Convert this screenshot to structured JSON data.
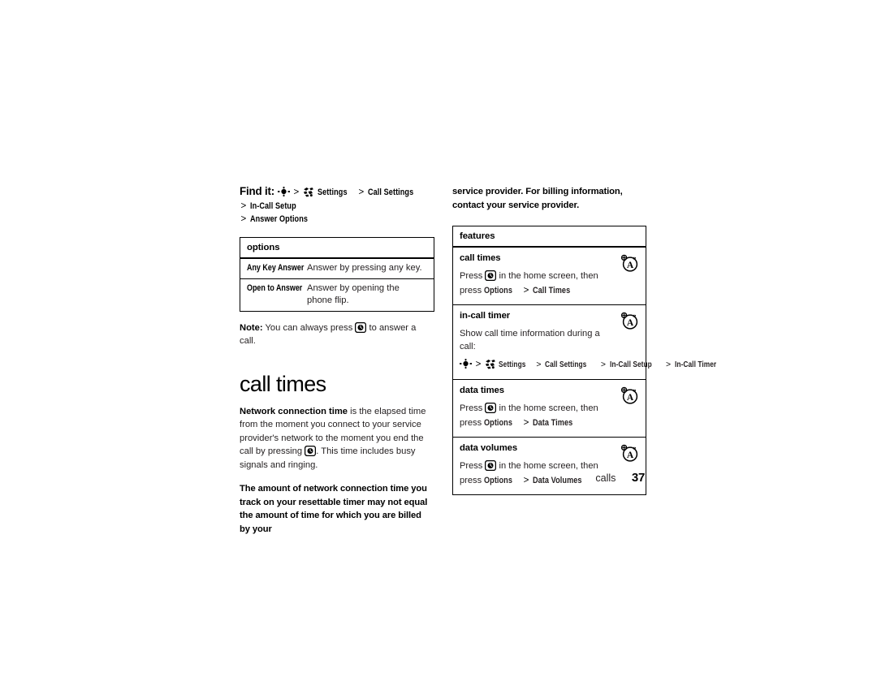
{
  "page": {
    "footer_section": "calls",
    "footer_page_number": "37"
  },
  "left_column": {
    "find_it": {
      "lead_label": "Find it:",
      "nav_icon": "navigation-key-icon",
      "menu_icon": "main-menu-icon",
      "separator": ">",
      "path": [
        "Settings",
        "Call Settings",
        "In-Call Setup",
        "Answer Options"
      ]
    },
    "options_table": {
      "header": "options",
      "rows": [
        {
          "key": "Any Key Answer",
          "value": "Answer by pressing any key."
        },
        {
          "key": "Open to Answer",
          "value": "Answer by opening the phone flip."
        }
      ]
    },
    "note": {
      "label": "Note:",
      "text_before_icon": "You can always press",
      "key_icon": "send-key-icon",
      "text_after_icon": "to answer a call."
    },
    "heading": "call times",
    "paragraph_1": {
      "bold_lead": "Network connection time",
      "text_before_icon": "is the elapsed time from the moment you connect to your service provider's network to the moment you end the call by pressing",
      "key_icon": "end-key-icon",
      "text_after_icon": ". This time includes busy signals and ringing."
    },
    "paragraph_2_bold": "The amount of network connection time you track on your resettable timer may not equal the amount of time for which you are billed by your"
  },
  "right_column": {
    "continued_paragraph_bold": "service provider. For billing information, contact your service provider.",
    "features_table": {
      "header": "features",
      "rows": [
        {
          "title": "call times",
          "annotation_icon": "personalize-feature-icon",
          "press_label": "Press",
          "key_icon": "send-key-icon",
          "line1_after_icon": "in the home screen, then",
          "line2_prefix": "press",
          "line2_path": [
            "Options",
            "Call Times"
          ]
        },
        {
          "title": "in-call timer",
          "annotation_icon": "personalize-feature-icon",
          "description": "Show call time information during a call:",
          "nav_icon": "navigation-key-icon",
          "menu_icon": "main-menu-icon",
          "path": [
            "Settings",
            "Call Settings",
            "In-Call Setup",
            "In-Call Timer"
          ]
        },
        {
          "title": "data times",
          "annotation_icon": "personalize-feature-icon",
          "press_label": "Press",
          "key_icon": "send-key-icon",
          "line1_after_icon": "in the home screen, then",
          "line2_prefix": "press",
          "line2_path": [
            "Options",
            "Data Times"
          ]
        },
        {
          "title": "data volumes",
          "annotation_icon": "personalize-feature-icon",
          "press_label": "Press",
          "key_icon": "send-key-icon",
          "line1_after_icon": "in the home screen, then",
          "line2_prefix": "press",
          "line2_path": [
            "Options",
            "Data Volumes"
          ]
        }
      ]
    }
  },
  "colors": {
    "text": "#231f20",
    "rule": "#000000",
    "background": "#ffffff"
  }
}
